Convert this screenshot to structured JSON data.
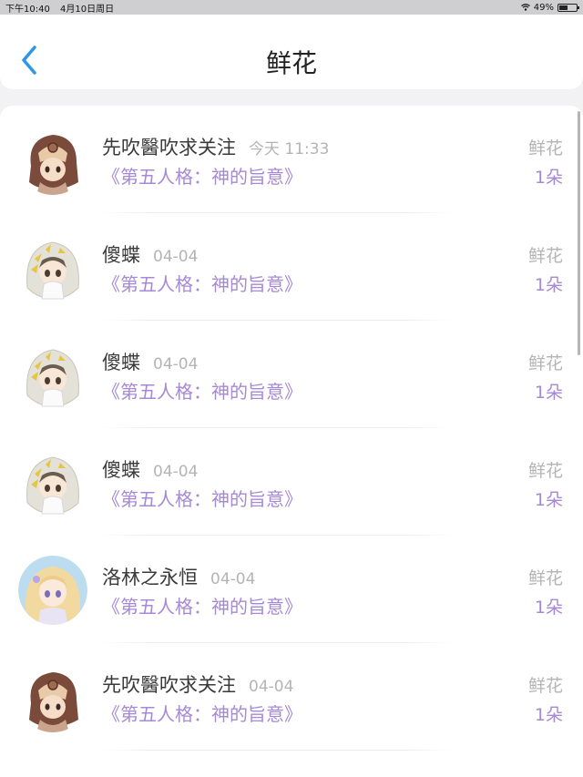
{
  "status_bar": {
    "time": "下午10:40",
    "date": "4月10日周日",
    "battery": "49%",
    "battery_level": 0.49
  },
  "header": {
    "title": "鲜花"
  },
  "items": [
    {
      "name": "先吹醫吹求关注",
      "time": "今天 11:33",
      "topic": "《第五人格：神的旨意》",
      "gift": "鲜花",
      "count": "1朵",
      "avatar": "brown-hood"
    },
    {
      "name": "傻蝶",
      "time": "04-04",
      "topic": "《第五人格：神的旨意》",
      "gift": "鲜花",
      "count": "1朵",
      "avatar": "white-hood"
    },
    {
      "name": "傻蝶",
      "time": "04-04",
      "topic": "《第五人格：神的旨意》",
      "gift": "鲜花",
      "count": "1朵",
      "avatar": "white-hood"
    },
    {
      "name": "傻蝶",
      "time": "04-04",
      "topic": "《第五人格：神的旨意》",
      "gift": "鲜花",
      "count": "1朵",
      "avatar": "white-hood"
    },
    {
      "name": "洛林之永恒",
      "time": "04-04",
      "topic": "《第五人格：神的旨意》",
      "gift": "鲜花",
      "count": "1朵",
      "avatar": "blonde-girl"
    },
    {
      "name": "先吹醫吹求关注",
      "time": "04-04",
      "topic": "《第五人格：神的旨意》",
      "gift": "鲜花",
      "count": "1朵",
      "avatar": "brown-hood"
    }
  ]
}
